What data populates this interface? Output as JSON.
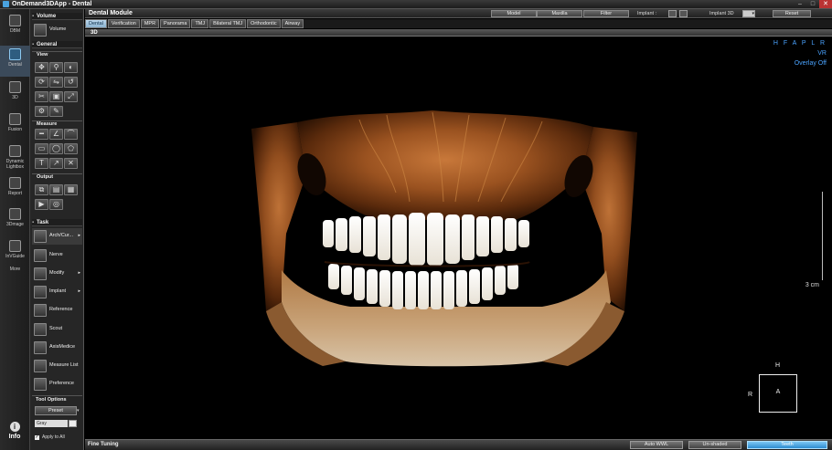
{
  "titlebar": {
    "title": "OnDemand3DApp - Dental",
    "min": "–",
    "max": "□",
    "close": "✕"
  },
  "leftnav": {
    "items": [
      {
        "label": "DBM",
        "icon": "database-icon"
      },
      {
        "label": "Dental",
        "icon": "tooth-icon"
      },
      {
        "label": "3D",
        "icon": "cube-3d-icon"
      },
      {
        "label": "Fusion",
        "icon": "fusion-icon"
      },
      {
        "label": "Dynamic Lightbox",
        "icon": "lightbox-icon"
      },
      {
        "label": "Report",
        "icon": "report-icon"
      },
      {
        "label": "3Dmage",
        "icon": "image3d-icon"
      },
      {
        "label": "InVGuide",
        "icon": "guide-icon"
      },
      {
        "label": "More",
        "icon": "more-icon"
      }
    ],
    "info_label": "Info",
    "info_glyph": "i"
  },
  "toolpanel": {
    "volume_header": "Volume",
    "volume_button": "Volume",
    "general_header": "General",
    "view_header": "View",
    "measure_header": "Measure",
    "output_header": "Output",
    "task_header": "Task",
    "tasks": [
      {
        "label": "Arch/Cur...",
        "arrow": "▸"
      },
      {
        "label": "Nerve",
        "arrow": ""
      },
      {
        "label": "Modify",
        "arrow": "▸"
      },
      {
        "label": "Implant",
        "arrow": "▸"
      },
      {
        "label": "Reference",
        "arrow": ""
      },
      {
        "label": "Scout",
        "arrow": ""
      },
      {
        "label": "AxisMedice",
        "arrow": ""
      },
      {
        "label": "Measure List",
        "arrow": ""
      },
      {
        "label": "Preference",
        "arrow": ""
      }
    ],
    "tool_options_header": "Tool Options",
    "preset_label": "Preset",
    "gray_value": "Gray",
    "apply_all_label": "Apply to All",
    "apply_all_checked": "✓"
  },
  "module": {
    "title": "Dental Module",
    "buttons": {
      "model": "Model",
      "maxilla": "Maxilla",
      "filter": "Filter",
      "reset": "Reset"
    },
    "implant_label": "Implant :",
    "implant3d_label": "Implant 3D",
    "implant3d_value": "▾"
  },
  "tabs": [
    {
      "label": "Dental",
      "active": true
    },
    {
      "label": "Verification",
      "active": false
    },
    {
      "label": "MPR",
      "active": false
    },
    {
      "label": "Panorama",
      "active": false
    },
    {
      "label": "TMJ",
      "active": false
    },
    {
      "label": "Bilateral TMJ",
      "active": false
    },
    {
      "label": "Orthodontic",
      "active": false
    },
    {
      "label": "Airway",
      "active": false
    }
  ],
  "view3d_label": "3D",
  "viewport": {
    "orientation": "H F A P L R",
    "mode": "VR",
    "overlay": "Overlay Off",
    "scale": "3 cm",
    "cube_front": "A",
    "cube_top": "H",
    "cube_left": "R",
    "image_description": "3D volume rendering of jaw and teeth"
  },
  "statusbar": {
    "fine_tuning": "Fine Tuning",
    "buttons": [
      {
        "label": "Auto WWL",
        "active": false
      },
      {
        "label": "Un-shaded",
        "active": false
      },
      {
        "label": "Teeth",
        "active": true
      }
    ]
  },
  "colors": {
    "accent": "#4aa3ff",
    "active_tab": "#a8c8e2",
    "active_button": "#2d8cd0"
  }
}
